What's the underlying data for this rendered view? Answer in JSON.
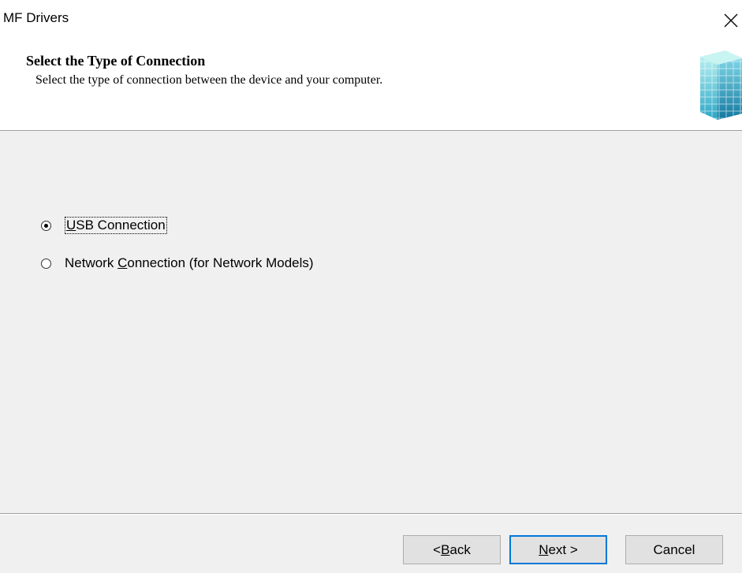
{
  "window": {
    "title": "MF Drivers",
    "close_icon": "close-icon"
  },
  "header": {
    "title": "Select the Type of Connection",
    "subtitle": "Select the type of connection between the device and your computer.",
    "logo_icon": "cube-logo-icon"
  },
  "options": [
    {
      "label_pre": "",
      "mnemonic": "U",
      "label_post": "SB Connection",
      "selected": true
    },
    {
      "label_pre": "Network ",
      "mnemonic": "C",
      "label_post": "onnection (for Network Models)",
      "selected": false
    }
  ],
  "buttons": {
    "back": {
      "pre": "< ",
      "mnemonic": "B",
      "post": "ack"
    },
    "next": {
      "pre": "",
      "mnemonic": "N",
      "post": "ext >"
    },
    "cancel": {
      "label": "Cancel"
    }
  },
  "colors": {
    "focus_border": "#0078d7",
    "cube_light": "#8fe3ea",
    "cube_dark": "#1a8fb0"
  }
}
